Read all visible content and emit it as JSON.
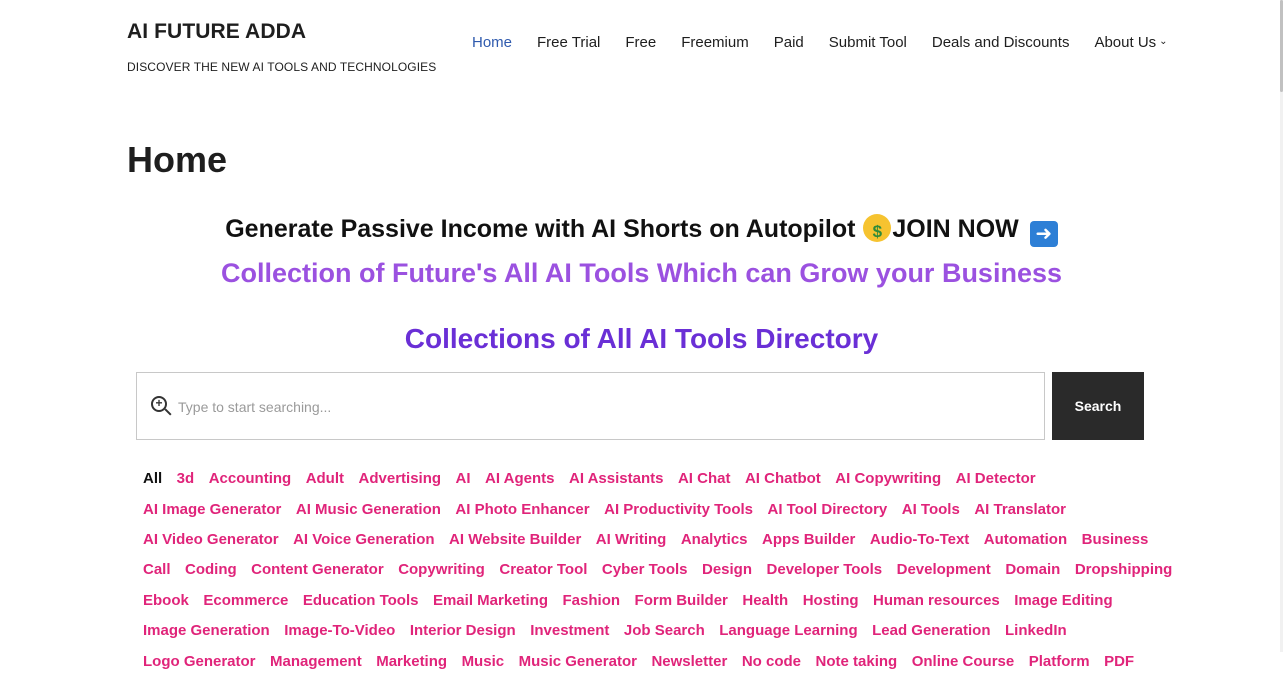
{
  "header": {
    "site_title": "AI FUTURE ADDA",
    "site_tagline": "DISCOVER THE NEW AI TOOLS AND TECHNOLOGIES",
    "nav": [
      {
        "label": "Home",
        "active": true
      },
      {
        "label": "Free Trial"
      },
      {
        "label": "Free"
      },
      {
        "label": "Freemium"
      },
      {
        "label": "Paid"
      },
      {
        "label": "Submit Tool"
      },
      {
        "label": "Deals and Discounts"
      },
      {
        "label": "About Us",
        "has_dropdown": true
      }
    ]
  },
  "page": {
    "title": "Home",
    "promo_text": "Generate Passive Income with AI Shorts on Autopilot",
    "promo_cta": "JOIN NOW",
    "tagline": "Collection of Future's All AI Tools Which can Grow your Business",
    "directory_title": "Collections of All AI Tools Directory"
  },
  "search": {
    "placeholder": "Type to start searching...",
    "button_label": "Search"
  },
  "tags": [
    [
      "All",
      "3d",
      "Accounting",
      "Adult",
      "Advertising",
      "AI",
      "AI Agents",
      "AI Assistants",
      "AI Chat",
      "AI Chatbot",
      "AI Copywriting",
      "AI Detector"
    ],
    [
      "AI Image Generator",
      "AI Music Generation",
      "AI Photo Enhancer",
      "AI Productivity Tools",
      "AI Tool Directory",
      "AI Tools",
      "AI Translator"
    ],
    [
      "AI Video Generator",
      "AI Voice Generation",
      "AI Website Builder",
      "AI Writing",
      "Analytics",
      "Apps Builder",
      "Audio-To-Text",
      "Automation",
      "Business"
    ],
    [
      "Call",
      "Coding",
      "Content Generator",
      "Copywriting",
      "Creator Tool",
      "Cyber Tools",
      "Design",
      "Developer Tools",
      "Development",
      "Domain",
      "Dropshipping"
    ],
    [
      "Ebook",
      "Ecommerce",
      "Education Tools",
      "Email Marketing",
      "Fashion",
      "Form Builder",
      "Health",
      "Hosting",
      "Human resources",
      "Image Editing"
    ],
    [
      "Image Generation",
      "Image-To-Video",
      "Interior Design",
      "Investment",
      "Job Search",
      "Language Learning",
      "Lead Generation",
      "LinkedIn"
    ],
    [
      "Logo Generator",
      "Management",
      "Marketing",
      "Music",
      "Music Generator",
      "Newsletter",
      "No code",
      "Note taking",
      "Online Course",
      "Platform",
      "PDF"
    ]
  ],
  "colors": {
    "tag": "#e0247a",
    "tag_active": "#111111",
    "nav_active": "#2f5aae",
    "tagline": "#9b51e0",
    "directory_title": "#6a2fd6",
    "search_button": "#2a2a2a"
  },
  "icons": {
    "search": "zoom-in-magnifier-icon",
    "promo_emoji": "money-mouth-face-icon",
    "cta_emoji": "right-arrow-icon",
    "about_dropdown": "chevron-down-icon"
  }
}
